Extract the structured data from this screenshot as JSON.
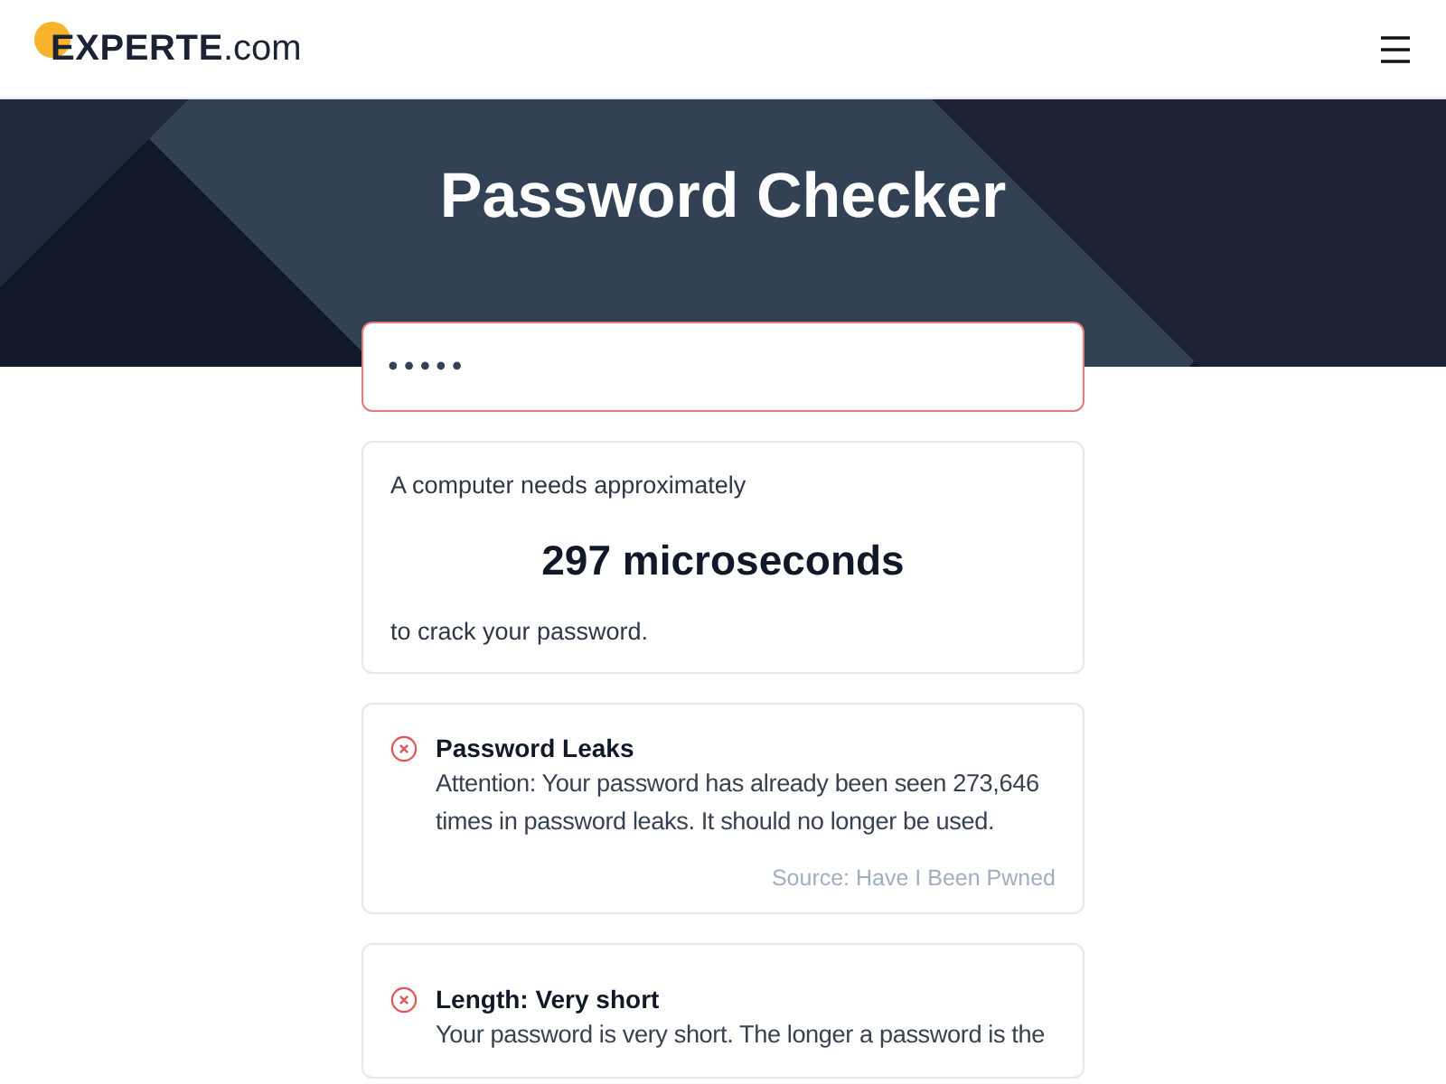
{
  "header": {
    "logo": {
      "brand": "EXPERTE",
      "suffix": ".com"
    }
  },
  "hero": {
    "title": "Password Checker"
  },
  "password_field": {
    "value": "•••••",
    "invalid": true
  },
  "result": {
    "intro": "A computer needs approximately",
    "time": "297 microseconds",
    "outro": "to crack your password."
  },
  "checks": [
    {
      "failed": true,
      "title": "Password Leaks",
      "text": "Attention: Your password has already been seen 273,646 times in password leaks. It should no longer be used.",
      "source": "Source: Have I Been Pwned"
    },
    {
      "failed": true,
      "title": "Length: Very short",
      "text": "Your password is very short. The longer a password is the"
    }
  ]
}
